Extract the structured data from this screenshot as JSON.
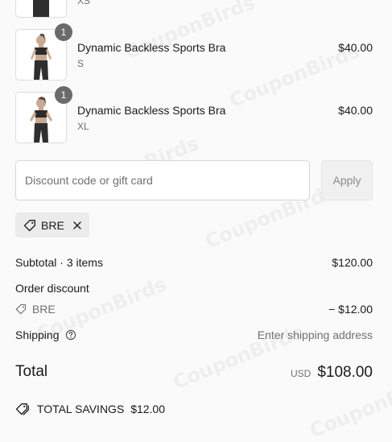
{
  "items": [
    {
      "name": "",
      "variant": "XS",
      "price": "",
      "quantity": ""
    },
    {
      "name": "Dynamic Backless Sports Bra",
      "variant": "S",
      "price": "$40.00",
      "quantity": "1"
    },
    {
      "name": "Dynamic Backless Sports Bra",
      "variant": "XL",
      "price": "$40.00",
      "quantity": "1"
    }
  ],
  "discount": {
    "placeholder": "Discount code or gift card",
    "apply_label": "Apply",
    "applied_code": "BRE"
  },
  "summary": {
    "subtotal_label": "Subtotal · 3 items",
    "subtotal_value": "$120.00",
    "order_discount_label": "Order discount",
    "discount_code": "BRE",
    "discount_value": "− $12.00",
    "shipping_label": "Shipping",
    "shipping_value": "Enter shipping address",
    "total_label": "Total",
    "currency": "USD",
    "total_value": "$108.00",
    "savings_label": "TOTAL SAVINGS",
    "savings_value": "$12.00"
  },
  "watermark": "CouponBirds",
  "icons": [
    "tag-icon",
    "close-icon",
    "help-icon",
    "savings-tag-icon"
  ]
}
